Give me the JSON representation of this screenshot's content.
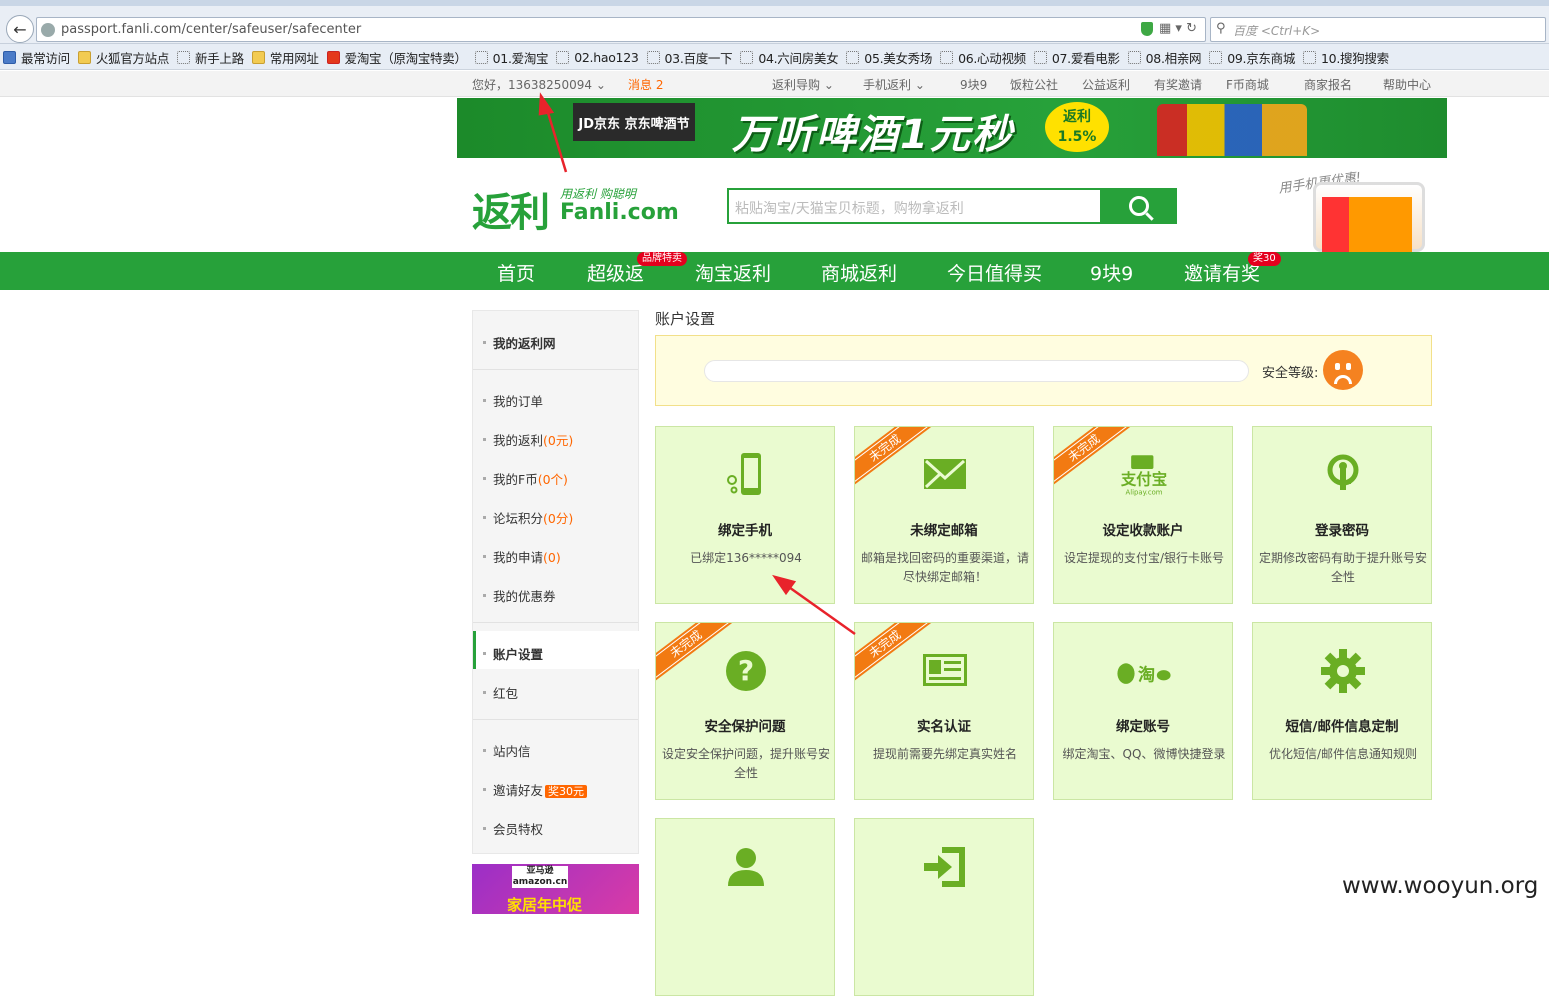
{
  "browser": {
    "url": "passport.fanli.com/center/safeuser/safecenter",
    "search_placeholder": "百度 <Ctrl+K>",
    "bookmarks": [
      {
        "label": "最常访问",
        "icon": "blue"
      },
      {
        "label": "火狐官方站点",
        "icon": "folder"
      },
      {
        "label": "新手上路",
        "icon": "page"
      },
      {
        "label": "常用网址",
        "icon": "folder"
      },
      {
        "label": "爱淘宝（原淘宝特卖）",
        "icon": "tao"
      },
      {
        "label": "01.爱淘宝",
        "icon": "page"
      },
      {
        "label": "02.hao123",
        "icon": "page"
      },
      {
        "label": "03.百度一下",
        "icon": "page"
      },
      {
        "label": "04.六间房美女",
        "icon": "page"
      },
      {
        "label": "05.美女秀场",
        "icon": "page"
      },
      {
        "label": "06.心动视频",
        "icon": "page"
      },
      {
        "label": "07.爱看电影",
        "icon": "page"
      },
      {
        "label": "08.相亲网",
        "icon": "page"
      },
      {
        "label": "09.京东商城",
        "icon": "page"
      },
      {
        "label": "10.搜狗搜索",
        "icon": "page"
      }
    ]
  },
  "topnav": {
    "greeting": "您好，13638250094",
    "messages": "消息 2",
    "links": [
      "返利导购",
      "手机返利",
      "9块9",
      "饭粒公社",
      "公益返利",
      "有奖邀请",
      "F币商城",
      "商家报名",
      "帮助中心"
    ]
  },
  "banner": {
    "jd_logo": "JD京东 京东啤酒节",
    "headline": "万听啤酒1元秒",
    "badge": "返利\n1.5%"
  },
  "logo": {
    "main": "返利",
    "slogan": "用返利 购聪明",
    "domain": "Fanli.com"
  },
  "search": {
    "placeholder": "粘贴淘宝/天猫宝贝标题，购物拿返利"
  },
  "app_promo": "用手机更优惠!",
  "mainnav": [
    {
      "label": "首页"
    },
    {
      "label": "超级返",
      "badge": "品牌特卖"
    },
    {
      "label": "淘宝返利"
    },
    {
      "label": "商城返利"
    },
    {
      "label": "今日值得买"
    },
    {
      "label": "9块9"
    },
    {
      "label": "邀请有奖",
      "badge": "奖30"
    }
  ],
  "sidebar": {
    "home": "我的返利网",
    "orders": "我的订单",
    "rebate": {
      "label": "我的返利",
      "count": "(0元)"
    },
    "fcoin": {
      "label": "我的F币",
      "count": "(0个)"
    },
    "forum": {
      "label": "论坛积分",
      "count": "(0分)"
    },
    "applications": {
      "label": "我的申请",
      "count": "(0)"
    },
    "coupons": "我的优惠券",
    "account": "账户设置",
    "redpacket": "红包",
    "inbox": "站内信",
    "invite": {
      "label": "邀请好友",
      "badge": "奖30元"
    },
    "vip": "会员特权",
    "ad": {
      "logo": "亚马逊 amazon.cn",
      "text": "家居年中促"
    }
  },
  "content": {
    "title": "账户设置",
    "security_label": "安全等级:",
    "incomplete": "未完成",
    "cards": [
      {
        "title": "绑定手机",
        "desc": "已绑定136*****094",
        "incomplete": false,
        "icon": "phone-icon"
      },
      {
        "title": "未绑定邮箱",
        "desc": "邮箱是找回密码的重要渠道，请尽快绑定邮箱！",
        "incomplete": true,
        "icon": "mail-icon"
      },
      {
        "title": "设定收款账户",
        "desc": "设定提现的支付宝/银行卡账号",
        "incomplete": true,
        "icon": "alipay-icon"
      },
      {
        "title": "登录密码",
        "desc": "定期修改密码有助于提升账号安全性",
        "incomplete": false,
        "icon": "key-icon"
      },
      {
        "title": "安全保护问题",
        "desc": "设定安全保护问题，提升账号安全性",
        "incomplete": true,
        "icon": "question-icon"
      },
      {
        "title": "实名认证",
        "desc": "提现前需要先绑定真实姓名",
        "incomplete": true,
        "icon": "id-card-icon"
      },
      {
        "title": "绑定账号",
        "desc": "绑定淘宝、QQ、微博快捷登录",
        "incomplete": false,
        "icon": "social-icon"
      },
      {
        "title": "短信/邮件信息定制",
        "desc": "优化短信/邮件信息通知规则",
        "incomplete": false,
        "icon": "gear-icon"
      },
      {
        "title": "",
        "desc": "",
        "incomplete": false,
        "icon": "user-icon"
      },
      {
        "title": "",
        "desc": "",
        "incomplete": false,
        "icon": "login-icon"
      }
    ]
  },
  "watermark": "www.wooyun.org",
  "colors": {
    "brand_green": "#27a13a",
    "accent_orange": "#f60",
    "card_bg": "#eafbd0"
  }
}
